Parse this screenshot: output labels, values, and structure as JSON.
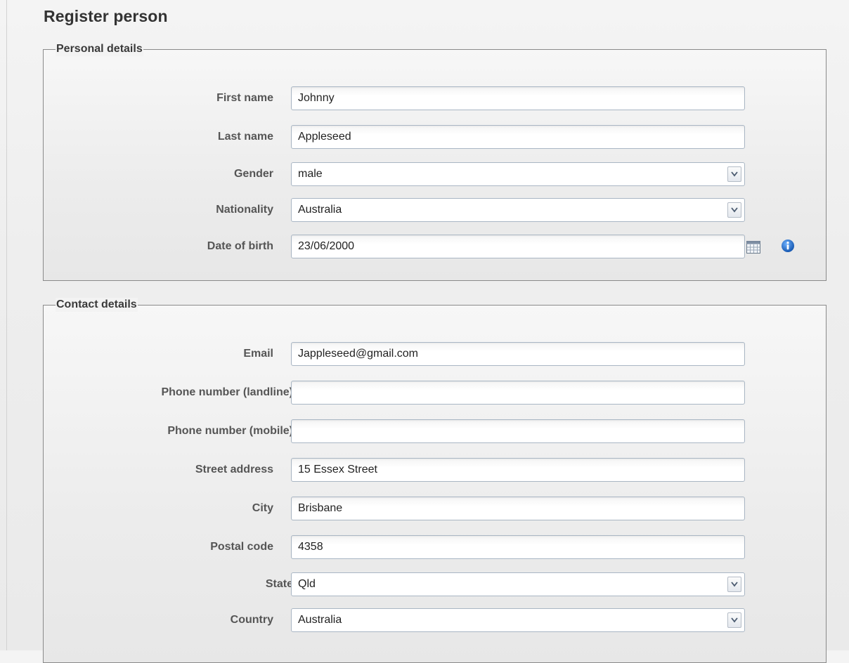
{
  "page": {
    "title": "Register person"
  },
  "personal": {
    "legend": "Personal details",
    "first_name": {
      "label": "First name",
      "value": "Johnny"
    },
    "last_name": {
      "label": "Last name",
      "value": "Appleseed"
    },
    "gender": {
      "label": "Gender",
      "value": "male"
    },
    "nationality": {
      "label": "Nationality",
      "value": "Australia"
    },
    "date_of_birth": {
      "label": "Date of birth",
      "value": "23/06/2000"
    }
  },
  "contact": {
    "legend": "Contact details",
    "email": {
      "label": "Email",
      "value": "Jappleseed@gmail.com"
    },
    "phone_landline": {
      "label": "Phone number (landline)",
      "value": ""
    },
    "phone_mobile": {
      "label": "Phone number (mobile)",
      "value": ""
    },
    "street_address": {
      "label": "Street address",
      "value": "15 Essex Street"
    },
    "city": {
      "label": "City",
      "value": "Brisbane"
    },
    "postal_code": {
      "label": "Postal code",
      "value": "4358"
    },
    "state": {
      "label": "State",
      "value": "Qld"
    },
    "country": {
      "label": "Country",
      "value": "Australia"
    }
  },
  "required_marker": "*",
  "icons": {
    "calendar": "calendar-icon",
    "info": "info-icon",
    "dropdown": "chevron-down-icon"
  },
  "colors": {
    "required_star": "#b3281f",
    "input_border": "#a9b6c4",
    "info_icon": "#1f6fc4"
  }
}
